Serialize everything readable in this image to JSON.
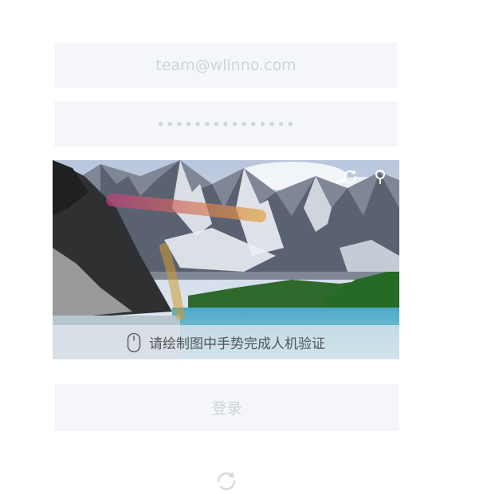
{
  "form": {
    "email_placeholder": "team@wlinno.com",
    "password_placeholder": "•••••••••••••••",
    "login_label": "登录"
  },
  "captcha": {
    "hint": "请绘制图中手势完成人机验证",
    "icons": {
      "mouse": "mouse-icon",
      "refresh": "refresh-icon",
      "close": "close-icon"
    },
    "image": "mountain-lake-landscape"
  },
  "footer": {
    "icon": "refresh-icon"
  },
  "colors": {
    "field_bg": "#f4f6fa",
    "placeholder": "#cfd4dc",
    "hint_text": "#555555"
  }
}
